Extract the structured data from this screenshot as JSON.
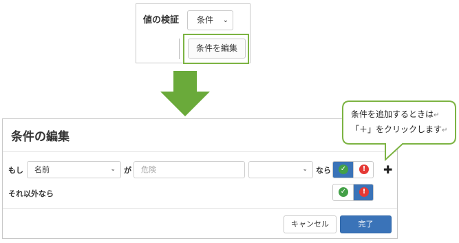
{
  "snippet": {
    "label": "値の検証",
    "select_value": "条件",
    "edit_button": "条件を編集"
  },
  "dialog": {
    "title": "条件の編集",
    "row1": {
      "if_label": "もし",
      "field_select": "名前",
      "ga_label": "が",
      "value_placeholder": "危険",
      "operator_select": "",
      "then_label": "なら"
    },
    "row2": {
      "otherwise_label": "それ以外なら"
    },
    "cancel_button": "キャンセル",
    "done_button": "完了",
    "add_icon": "plus-icon"
  },
  "callout": {
    "line1": "条件を追加するときは",
    "line2": "「＋」をクリックします",
    "return_mark": "↵"
  },
  "colors": {
    "highlight_green": "#7cb342",
    "arrow_green": "#6aaa3a",
    "primary_blue": "#3a73b8",
    "ok_green": "#43a047",
    "error_red": "#e53935"
  }
}
